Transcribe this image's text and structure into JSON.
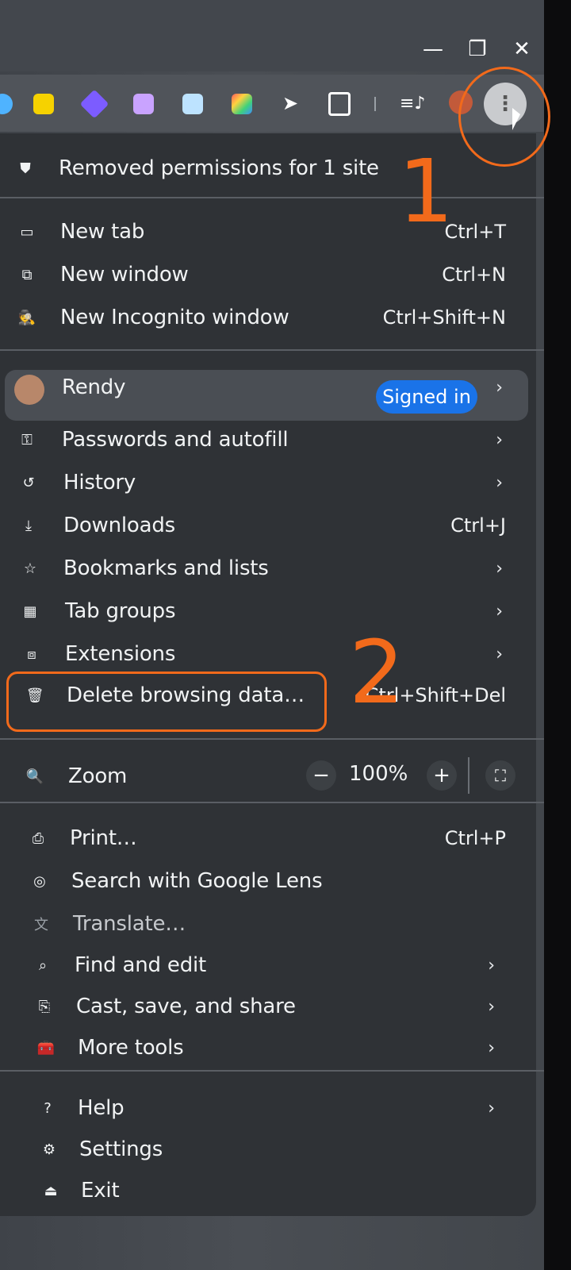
{
  "window": {
    "minimize": "—",
    "restore": "❐",
    "close": "✕"
  },
  "toolbar": {
    "menu_icon": "more-vert-icon"
  },
  "notice": {
    "label": "Removed permissions for 1 site"
  },
  "items_top": [
    {
      "label": "New tab",
      "shortcut": "Ctrl+T"
    },
    {
      "label": "New window",
      "shortcut": "Ctrl+N"
    },
    {
      "label": "New Incognito window",
      "shortcut": "Ctrl+Shift+N"
    }
  ],
  "profile": {
    "name": "Rendy",
    "status": "Signed in"
  },
  "items_mid": [
    {
      "label": "Passwords and autofill"
    },
    {
      "label": "History"
    },
    {
      "label": "Downloads",
      "shortcut": "Ctrl+J"
    },
    {
      "label": "Bookmarks and lists"
    },
    {
      "label": "Tab groups"
    },
    {
      "label": "Extensions"
    },
    {
      "label": "Delete browsing data…",
      "shortcut": "Ctrl+Shift+Del"
    }
  ],
  "zoom": {
    "label": "Zoom",
    "minus": "−",
    "value": "100%",
    "plus": "+"
  },
  "items_tools": [
    {
      "label": "Print…",
      "shortcut": "Ctrl+P"
    },
    {
      "label": "Search with Google Lens"
    },
    {
      "label": "Translate…"
    },
    {
      "label": "Find and edit"
    },
    {
      "label": "Cast, save, and share"
    },
    {
      "label": "More tools"
    }
  ],
  "items_bottom": [
    {
      "label": "Help"
    },
    {
      "label": "Settings"
    },
    {
      "label": "Exit"
    }
  ],
  "annotations": {
    "step1": "1",
    "step2": "2",
    "color": "#f26a1b"
  }
}
